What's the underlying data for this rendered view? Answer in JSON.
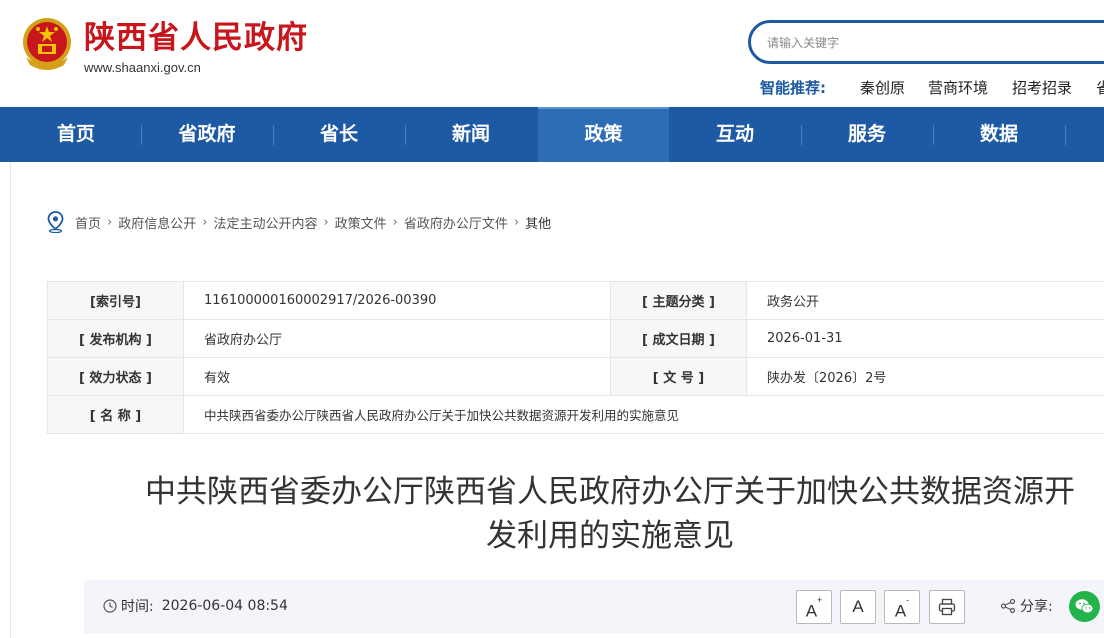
{
  "header": {
    "title": "陕西省人民政府",
    "url": "www.shaanxi.gov.cn",
    "search_placeholder": "请输入关键字",
    "hot_label": "智能推荐:",
    "hot_links": [
      "秦创原",
      "营商环境",
      "招考招录",
      "省"
    ]
  },
  "nav": {
    "items": [
      "首页",
      "省政府",
      "省长",
      "新闻",
      "政策",
      "互动",
      "服务",
      "数据"
    ],
    "active": "政策"
  },
  "breadcrumb": {
    "items": [
      "首页",
      "政府信息公开",
      "法定主动公开内容",
      "政策文件",
      "省政府办公厅文件",
      "其他"
    ]
  },
  "meta": {
    "index_label": "[索引号]",
    "index_value": "116100000160002917/2026-00390",
    "topic_label": "[ 主题分类 ]",
    "topic_value": "政务公开",
    "publisher_label": "[ 发布机构 ]",
    "publisher_value": "省政府办公厅",
    "date_label": "[ 成文日期 ]",
    "date_value": "2026-01-31",
    "status_label": "[ 效力状态 ]",
    "status_value": "有效",
    "docno_label": "[ 文 号 ]",
    "docno_value": "陕办发〔2026〕2号",
    "name_label": "[ 名 称 ]",
    "name_value": "中共陕西省委办公厅陕西省人民政府办公厅关于加快公共数据资源开发利用的实施意见"
  },
  "article": {
    "title_line1": "中共陕西省委办公厅陕西省人民政府办公厅关于加快公共数据资源开",
    "title_line2": "发利用的实施意见",
    "time_label": "时间:",
    "time_value": "2026-06-04 08:54",
    "font_large": "A",
    "font_medium": "A",
    "font_small": "A",
    "share_label": "分享:"
  },
  "colors": {
    "brand_red": "#c8161d",
    "nav_blue": "#1d5aa3",
    "wechat_green": "#24b24a"
  }
}
